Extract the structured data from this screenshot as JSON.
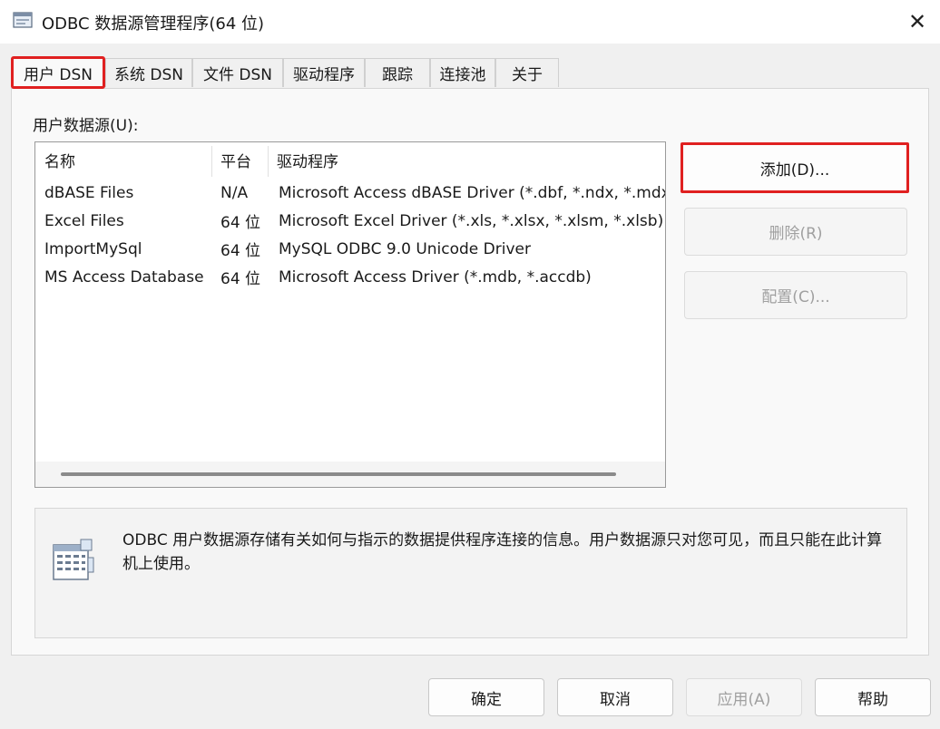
{
  "window": {
    "title": "ODBC 数据源管理程序(64 位)",
    "close_glyph": "✕"
  },
  "tabs": [
    {
      "label": "用户 DSN"
    },
    {
      "label": "系统 DSN"
    },
    {
      "label": "文件 DSN"
    },
    {
      "label": "驱动程序"
    },
    {
      "label": "跟踪"
    },
    {
      "label": "连接池"
    },
    {
      "label": "关于"
    }
  ],
  "user_dsn": {
    "section_label": "用户数据源(U):",
    "columns": [
      "名称",
      "平台",
      "驱动程序"
    ],
    "rows": [
      {
        "name": "dBASE Files",
        "platform": "N/A",
        "driver": "Microsoft Access dBASE Driver (*.dbf, *.ndx, *.mdx)"
      },
      {
        "name": "Excel Files",
        "platform": "64 位",
        "driver": "Microsoft Excel Driver (*.xls, *.xlsx, *.xlsm, *.xlsb)"
      },
      {
        "name": "ImportMySql",
        "platform": "64 位",
        "driver": "MySQL ODBC 9.0 Unicode Driver"
      },
      {
        "name": "MS Access Database",
        "platform": "64 位",
        "driver": "Microsoft Access Driver (*.mdb, *.accdb)"
      }
    ],
    "buttons": {
      "add": "添加(D)...",
      "remove": "删除(R)",
      "configure": "配置(C)..."
    },
    "info_text": "ODBC 用户数据源存储有关如何与指示的数据提供程序连接的信息。用户数据源只对您可见，而且只能在此计算机上使用。"
  },
  "footer": {
    "ok": "确定",
    "cancel": "取消",
    "apply": "应用(A)",
    "help": "帮助"
  },
  "colors": {
    "highlight": "#e02020",
    "disabled_text": "#a0a0a0"
  }
}
